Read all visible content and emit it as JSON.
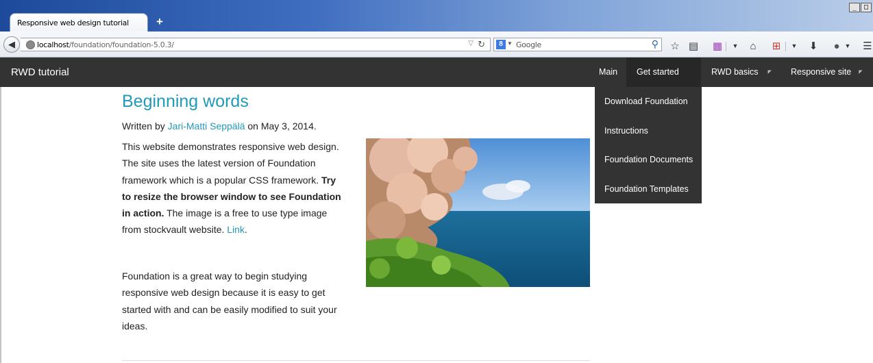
{
  "browser": {
    "tab_title": "Responsive web design tutorial",
    "new_tab": "+",
    "url_host": "localhost",
    "url_path": "/foundation/foundation-5.0.3/",
    "search_engine_icon": "8",
    "search_placeholder": "Google",
    "window_min": "_",
    "window_max": "□"
  },
  "site": {
    "brand": "RWD tutorial",
    "nav": [
      {
        "label": "Main"
      },
      {
        "label": "Get started",
        "active": true
      },
      {
        "label": "RWD basics"
      },
      {
        "label": "Responsive site"
      }
    ],
    "dropdown": [
      {
        "label": "Download Foundation"
      },
      {
        "label": "Instructions"
      },
      {
        "label": "Foundation Documents"
      },
      {
        "label": "Foundation Templates"
      }
    ]
  },
  "article": {
    "title": "Beginning words",
    "byline_prefix": "Written by ",
    "author": "Jari-Matti Seppälä",
    "byline_suffix": " on May 3, 2014.",
    "p1_a": "This website demonstrates responsive web design. The site uses the latest version of Foundation framework which is a popular CSS framework. ",
    "p1_bold": "Try to resize the browser window to see Foundation in action.",
    "p1_b": " The image is a free to use type image from stockvault website. ",
    "p1_link": "Link",
    "p1_end": ".",
    "p2": "Foundation is a great way to begin studying responsive web design because it is easy to get started with and can be easily modified to suit your ideas."
  },
  "colors": {
    "topbar": "#333333",
    "link": "#2199b8"
  }
}
